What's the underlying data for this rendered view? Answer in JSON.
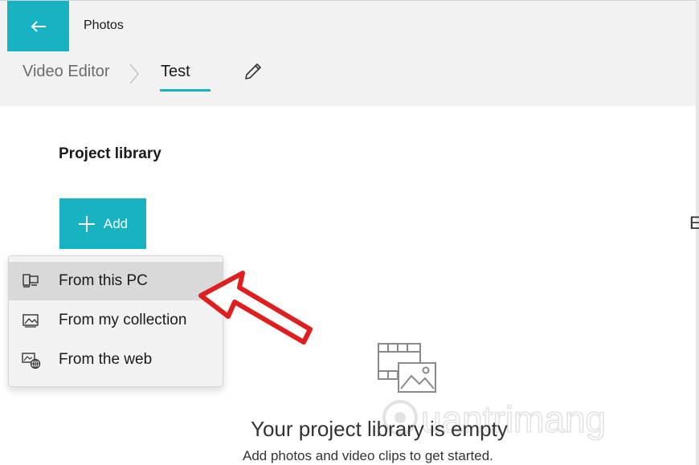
{
  "app": {
    "title": "Photos"
  },
  "breadcrumb": {
    "root": "Video Editor",
    "current": "Test"
  },
  "library": {
    "title": "Project library",
    "add_label": "Add"
  },
  "add_menu": {
    "items": [
      {
        "label": "From this PC",
        "icon": "pc-icon",
        "highlighted": true
      },
      {
        "label": "From my collection",
        "icon": "collection-icon",
        "highlighted": false
      },
      {
        "label": "From the web",
        "icon": "web-icon",
        "highlighted": false
      }
    ]
  },
  "empty_state": {
    "title": "Your project library is empty",
    "subtitle": "Add photos and video clips to get started."
  },
  "cut_off_text": "E",
  "watermark_text": "uantrimang",
  "colors": {
    "accent": "#17b3c2",
    "arrow": "#e01e1e"
  }
}
